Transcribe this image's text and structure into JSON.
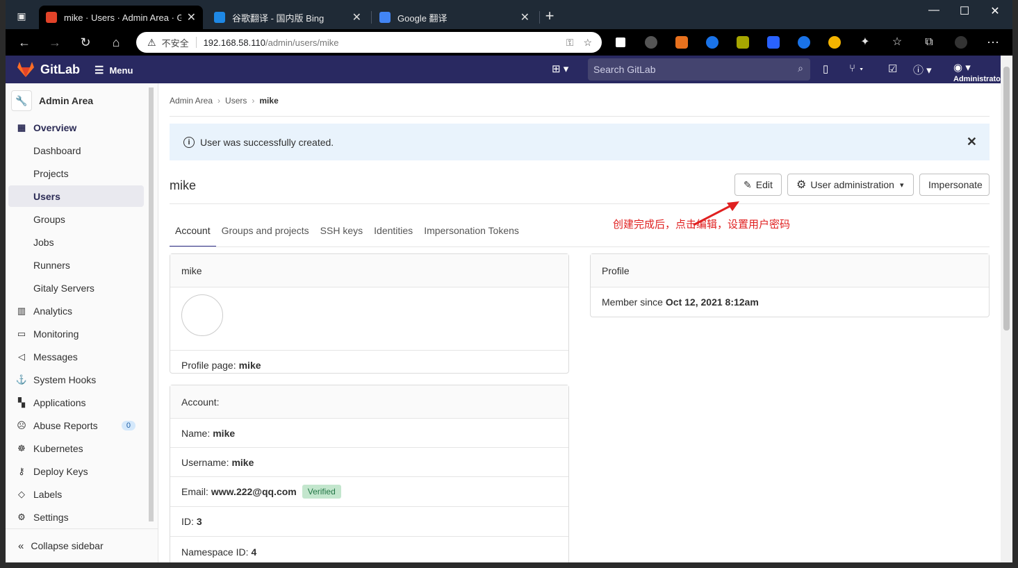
{
  "browser": {
    "tabs": [
      {
        "title": "mike · Users · Admin Area · GitLa",
        "active": true
      },
      {
        "title": "谷歌翻译 - 国内版 Bing",
        "active": false
      },
      {
        "title": "Google 翻译",
        "active": false
      }
    ],
    "new_tab": "+",
    "url_warning": "不安全",
    "url_host": "192.168.58.110",
    "url_path": "/admin/users/mike"
  },
  "header": {
    "logo_text": "GitLab",
    "menu_label": "Menu",
    "search_placeholder": "Search GitLab",
    "user_label": "Administrato"
  },
  "sidebar": {
    "title": "Admin Area",
    "items": [
      {
        "label": "Overview",
        "icon": "grid-icon",
        "top": true
      },
      {
        "label": "Dashboard",
        "sub": true
      },
      {
        "label": "Projects",
        "sub": true
      },
      {
        "label": "Users",
        "sub": true,
        "selected": true
      },
      {
        "label": "Groups",
        "sub": true
      },
      {
        "label": "Jobs",
        "sub": true
      },
      {
        "label": "Runners",
        "sub": true
      },
      {
        "label": "Gitaly Servers",
        "sub": true
      },
      {
        "label": "Analytics",
        "icon": "chart-icon"
      },
      {
        "label": "Monitoring",
        "icon": "monitor-icon"
      },
      {
        "label": "Messages",
        "icon": "bullhorn-icon"
      },
      {
        "label": "System Hooks",
        "icon": "hook-icon"
      },
      {
        "label": "Applications",
        "icon": "apps-icon"
      },
      {
        "label": "Abuse Reports",
        "icon": "abuse-icon",
        "badge": "0"
      },
      {
        "label": "Kubernetes",
        "icon": "kubernetes-icon"
      },
      {
        "label": "Deploy Keys",
        "icon": "key-icon"
      },
      {
        "label": "Labels",
        "icon": "label-icon"
      },
      {
        "label": "Settings",
        "icon": "gear-icon"
      }
    ],
    "collapse_label": "Collapse sidebar"
  },
  "breadcrumb": [
    "Admin Area",
    "Users",
    "mike"
  ],
  "alert": {
    "text": "User was successfully created."
  },
  "page": {
    "username": "mike",
    "edit_label": "Edit",
    "user_admin_label": "User administration",
    "impersonate_label": "Impersonate",
    "annotation": "创建完成后，点击编辑，设置用户密码",
    "tabs": [
      "Account",
      "Groups and projects",
      "SSH keys",
      "Identities",
      "Impersonation Tokens"
    ]
  },
  "profile_card": {
    "header": "mike",
    "profile_page_label": "Profile page:",
    "profile_page_value": "mike"
  },
  "account_card": {
    "header": "Account:",
    "name_label": "Name:",
    "name_value": "mike",
    "username_label": "Username:",
    "username_value": "mike",
    "email_label": "Email:",
    "email_value": "www.222@qq.com",
    "verified_label": "Verified",
    "id_label": "ID:",
    "id_value": "3",
    "namespace_label": "Namespace ID:",
    "namespace_value": "4"
  },
  "profile_right": {
    "header": "Profile",
    "member_since_label": "Member since",
    "member_since_value": "Oct 12, 2021 8:12am"
  },
  "colors": {
    "header_bg": "#292961",
    "accent": "#2f2f8a",
    "alert_bg": "#e9f3fc",
    "annotation": "#e02020"
  }
}
